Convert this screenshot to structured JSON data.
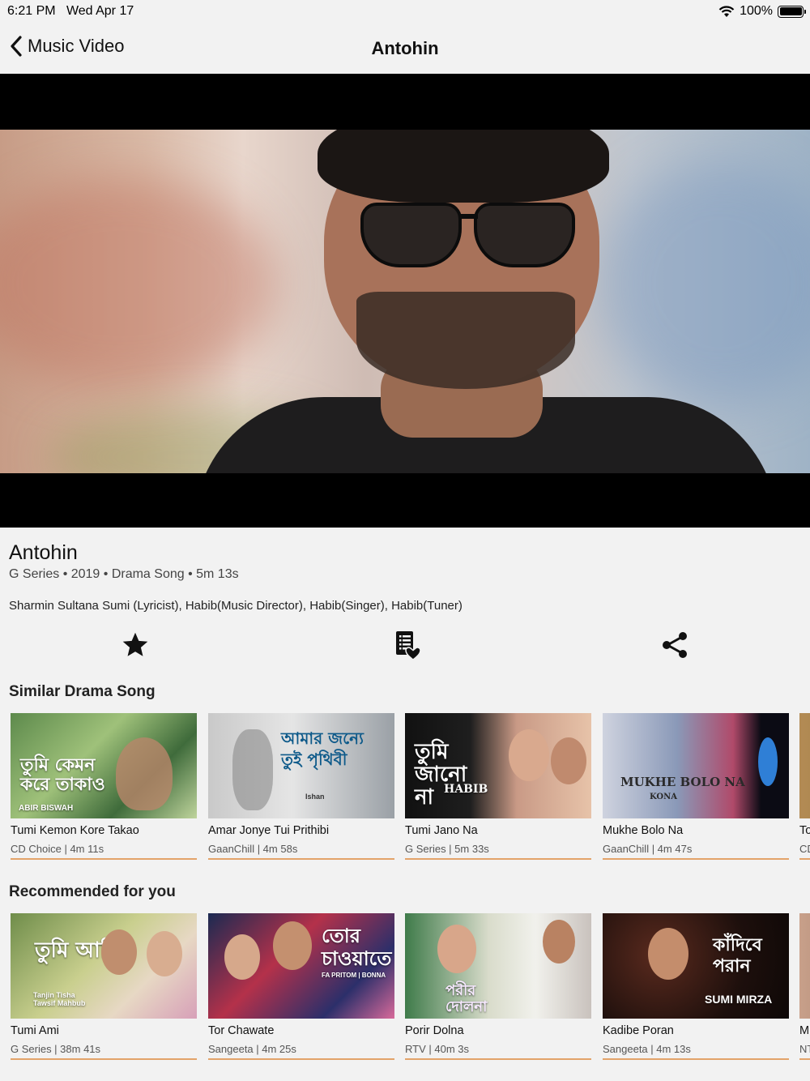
{
  "status_bar": {
    "time": "6:21 PM",
    "date": "Wed Apr 17",
    "battery": "100%"
  },
  "nav": {
    "back_label": "Music Video",
    "title": "Antohin"
  },
  "song": {
    "title": "Antohin",
    "meta": "G Series • 2019 • Drama Song • 5m 13s",
    "credits": "Sharmin Sultana Sumi (Lyricist), Habib(Music Director), Habib(Singer), Habib(Tuner)"
  },
  "actions": {
    "favorite_icon": "star-icon",
    "playlist_icon": "playlist-heart-icon",
    "share_icon": "share-icon"
  },
  "similar": {
    "title": "Similar Drama Song",
    "items": [
      {
        "name": "Tumi Kemon Kore Takao",
        "sub": "CD Choice  |  4m 11s",
        "thumb_text": "তুমি কেমন করে তাকাও",
        "thumb_caption": "ABIR BISWAH"
      },
      {
        "name": "Amar Jonye Tui Prithibi",
        "sub": "GaanChill  |  4m 58s",
        "thumb_text": "আমার জন্যে তুই পৃথিবী",
        "thumb_caption": "Ishan"
      },
      {
        "name": "Tumi Jano Na",
        "sub": "G Series  |  5m 33s",
        "thumb_text": "তুমি জানো না",
        "thumb_caption": "HABIB"
      },
      {
        "name": "Mukhe Bolo Na",
        "sub": "GaanChill  |  4m 47s",
        "thumb_text": "MUKHE BOLO NA",
        "thumb_caption": "KONA"
      },
      {
        "name": "To",
        "sub": "CD"
      }
    ]
  },
  "recommended": {
    "title": "Recommended for you",
    "items": [
      {
        "name": "Tumi Ami",
        "sub": "G Series  |  38m 41s",
        "thumb_text": "তুমি আমি",
        "thumb_caption": "Tanjin Tisha Tawsif Mahbub"
      },
      {
        "name": "Tor Chawate",
        "sub": "Sangeeta  |  4m 25s",
        "thumb_text": "তোর চাওয়াতে",
        "thumb_caption": "FA PRITOM | BONNA"
      },
      {
        "name": "Porir Dolna",
        "sub": "RTV  |  40m 3s",
        "thumb_text": "পরীর দোলনা",
        "thumb_caption": ""
      },
      {
        "name": "Kadibe Poran",
        "sub": "Sangeeta  |  4m 13s",
        "thumb_text": "কাঁদিবে পরান",
        "thumb_caption": "SUMI MIRZA"
      },
      {
        "name": "M",
        "sub": "NT"
      }
    ]
  },
  "colors": {
    "accent_line": "#e3a36a",
    "background": "#f2f2f2"
  }
}
